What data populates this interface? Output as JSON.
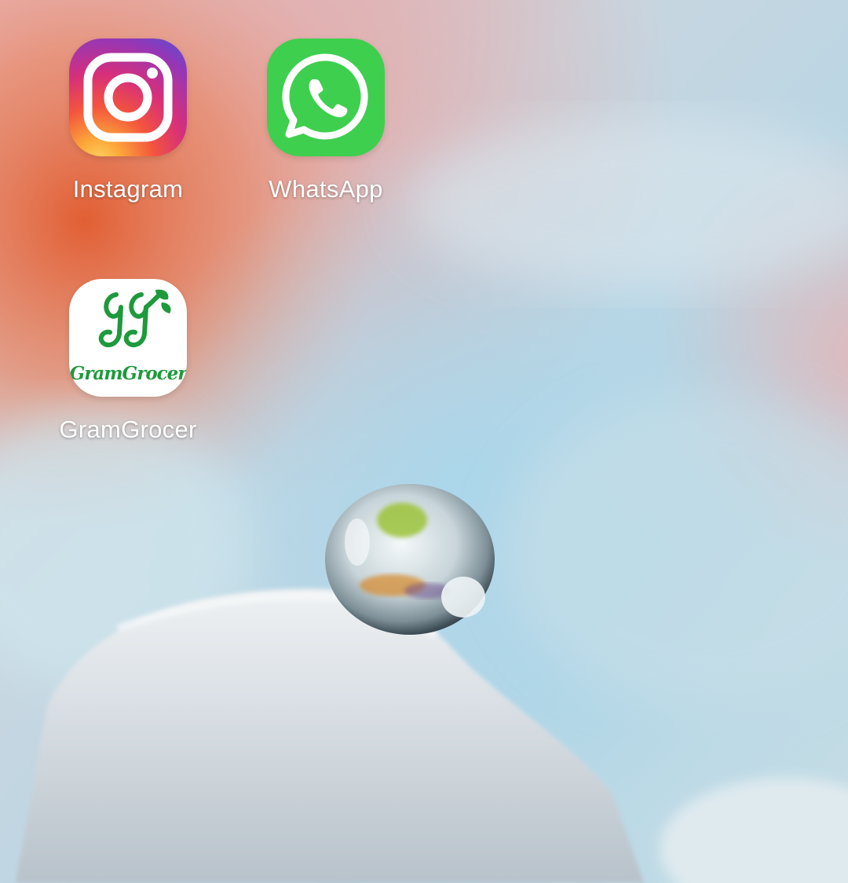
{
  "home_screen": {
    "apps": [
      {
        "label": "Instagram",
        "icon": "instagram-icon"
      },
      {
        "label": "WhatsApp",
        "icon": "whatsapp-icon"
      },
      {
        "label": "GramGrocer",
        "icon": "gramgrocer-icon",
        "logo_text": "GramGrocer"
      }
    ]
  },
  "wallpaper": {
    "description_icon": "water-droplet-on-petal",
    "colors": {
      "sky": "#b9d8e6",
      "petal_pink": "#e6a8a6",
      "petal_orange": "#e0643a",
      "petal_white": "#f1f4f6"
    }
  },
  "colors": {
    "label_text": "#ffffff",
    "whatsapp_green": "#3ecf4f",
    "gramgrocer_green": "#1e9a3c"
  }
}
